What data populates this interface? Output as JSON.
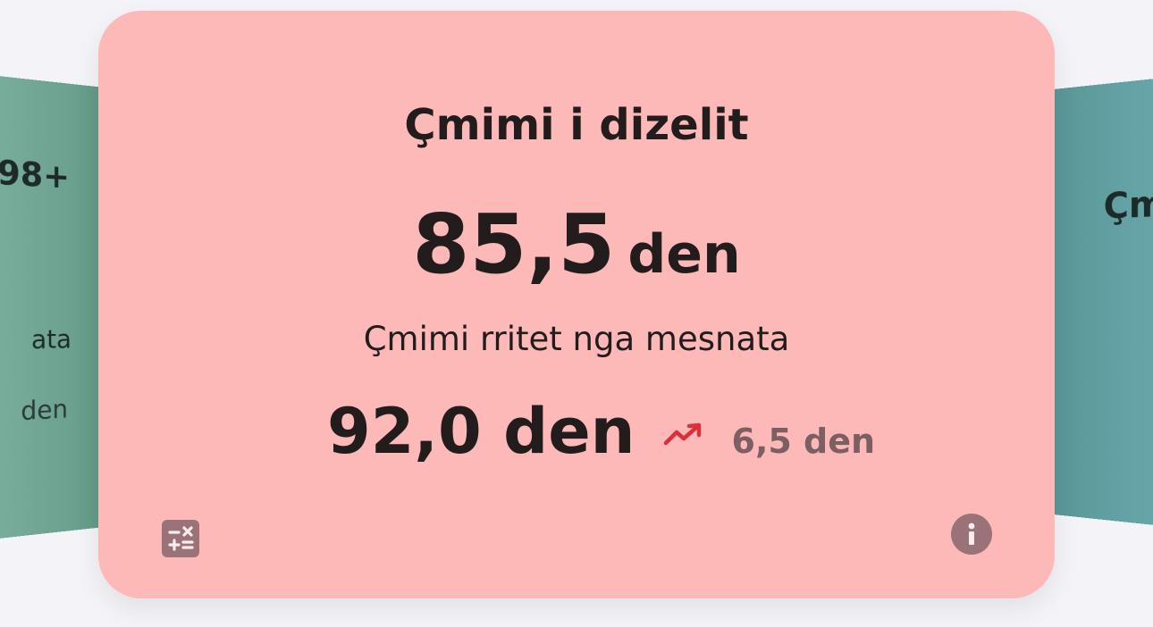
{
  "left_card": {
    "price_fragment": "98+",
    "subtitle_fragment": "ata",
    "next_fragment": "den"
  },
  "right_card": {
    "title_fragment": "Çm"
  },
  "main_card": {
    "title": "Çmimi i dizelit",
    "price_value": "85,5",
    "price_unit": "den",
    "subtitle": "Çmimi rritet nga mesnata",
    "next_price": "92,0 den",
    "trend_icon": "trending-up-icon",
    "change": "6,5 den",
    "calculator_icon": "calculator-icon",
    "info_icon": "info-icon"
  },
  "colors": {
    "main_card_bg": "#fdb8b8",
    "trend_red": "#d9313a",
    "muted_icon": "#9a7378",
    "left_card_bg": "#6aa08d",
    "right_card_bg": "#63a2a5"
  }
}
